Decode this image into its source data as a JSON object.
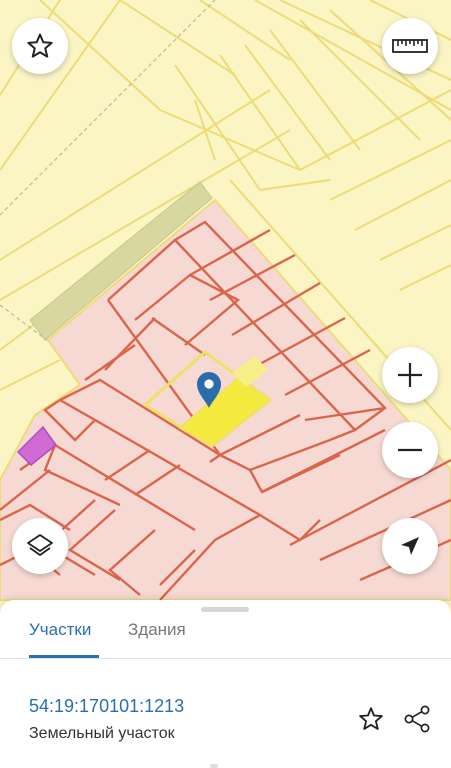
{
  "map": {
    "colors": {
      "background": "#fbf5c4",
      "yellow_outline": "#ecdc78",
      "pink_fill": "#f6d9d2",
      "red_outline": "#d9664c",
      "selected_fill": "#f5eb3f",
      "road_fill": "#d8d7a0",
      "purple_fill": "#d06ad4",
      "marker": "#2b6cab"
    },
    "icons": {
      "favorite": "star-icon",
      "ruler": "ruler-icon",
      "zoom_in": "plus-icon",
      "zoom_out": "minus-icon",
      "layers": "layers-icon",
      "locate": "navigation-arrow-icon",
      "marker": "location-pin-icon"
    }
  },
  "sheet": {
    "tabs": [
      {
        "label": "Участки",
        "active": true
      },
      {
        "label": "Здания",
        "active": false
      }
    ],
    "parcel": {
      "cadastral_number": "54:19:170101:1213",
      "type": "Земельный участок"
    },
    "icons": {
      "favorite": "star-outline-icon",
      "share": "share-icon"
    }
  }
}
